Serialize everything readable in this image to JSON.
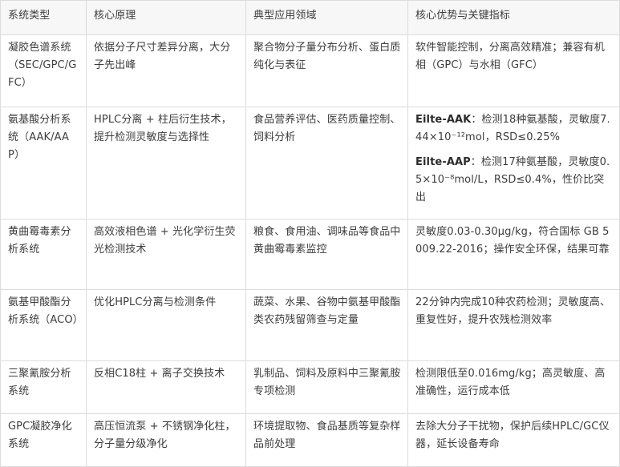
{
  "headers": [
    "系统类型",
    "核心原理",
    "典型应用领域",
    "核心优势与关键指标"
  ],
  "rows": [
    {
      "type": "凝胶色谱系统（SEC/GPC/GFC）",
      "principle": "依据分子尺寸差异分离，大分子先出峰",
      "application": "聚合物分子量分布分析、蛋白质纯化与表征",
      "advantage": "软件智能控制，分离高效精准；兼容有机相（GPC）与水相（GFC）"
    },
    {
      "type": "氨基酸分析系统（AAK/AAP）",
      "principle": "HPLC分离 + 柱后衍生技术，提升检测灵敏度与选择性",
      "application": "食品营养评估、医药质量控制、饲料分析",
      "adv1_bold": "Eilte-AAK",
      "adv1_text": "：检测18种氨基酸，灵敏度7.44×10⁻¹²mol，RSD≤0.25%",
      "adv2_bold": "Eilte-AAP",
      "adv2_text": "：检测17种氨基酸，灵敏度0.5×10⁻⁸mol/L，RSD≤0.4%，性价比突出"
    },
    {
      "type": "黄曲霉毒素分析系统",
      "principle": "高效液相色谱 + 光化学衍生荧光检测技术",
      "application": "粮食、食用油、调味品等食品中黄曲霉毒素监控",
      "advantage": "灵敏度0.03-0.30μg/kg，符合国标 GB 5009.22-2016；操作安全环保，结果可靠"
    },
    {
      "type": "氨基甲酸酯分析系统（ACO）",
      "principle": "优化HPLC分离与检测条件",
      "application": "蔬菜、水果、谷物中氨基甲酸酯类农药残留筛查与定量",
      "advantage": "22分钟内完成10种农药检测；灵敏度高、重复性好，提升农残检测效率"
    },
    {
      "type": "三聚氰胺分析系统",
      "principle": "反相C18柱 + 离子交换技术",
      "application": "乳制品、饲料及原料中三聚氰胺专项检测",
      "advantage": "检测限低至0.016mg/kg；高灵敏度、高准确性，运行成本低"
    },
    {
      "type": "GPC凝胶净化系统",
      "principle": "高压恒流泵 + 不锈钢净化柱，分子量分级净化",
      "application": "环境提取物、食品基质等复杂样品前处理",
      "advantage": "去除大分子干扰物，保护后续HPLC/GC仪器，延长设备寿命"
    }
  ]
}
